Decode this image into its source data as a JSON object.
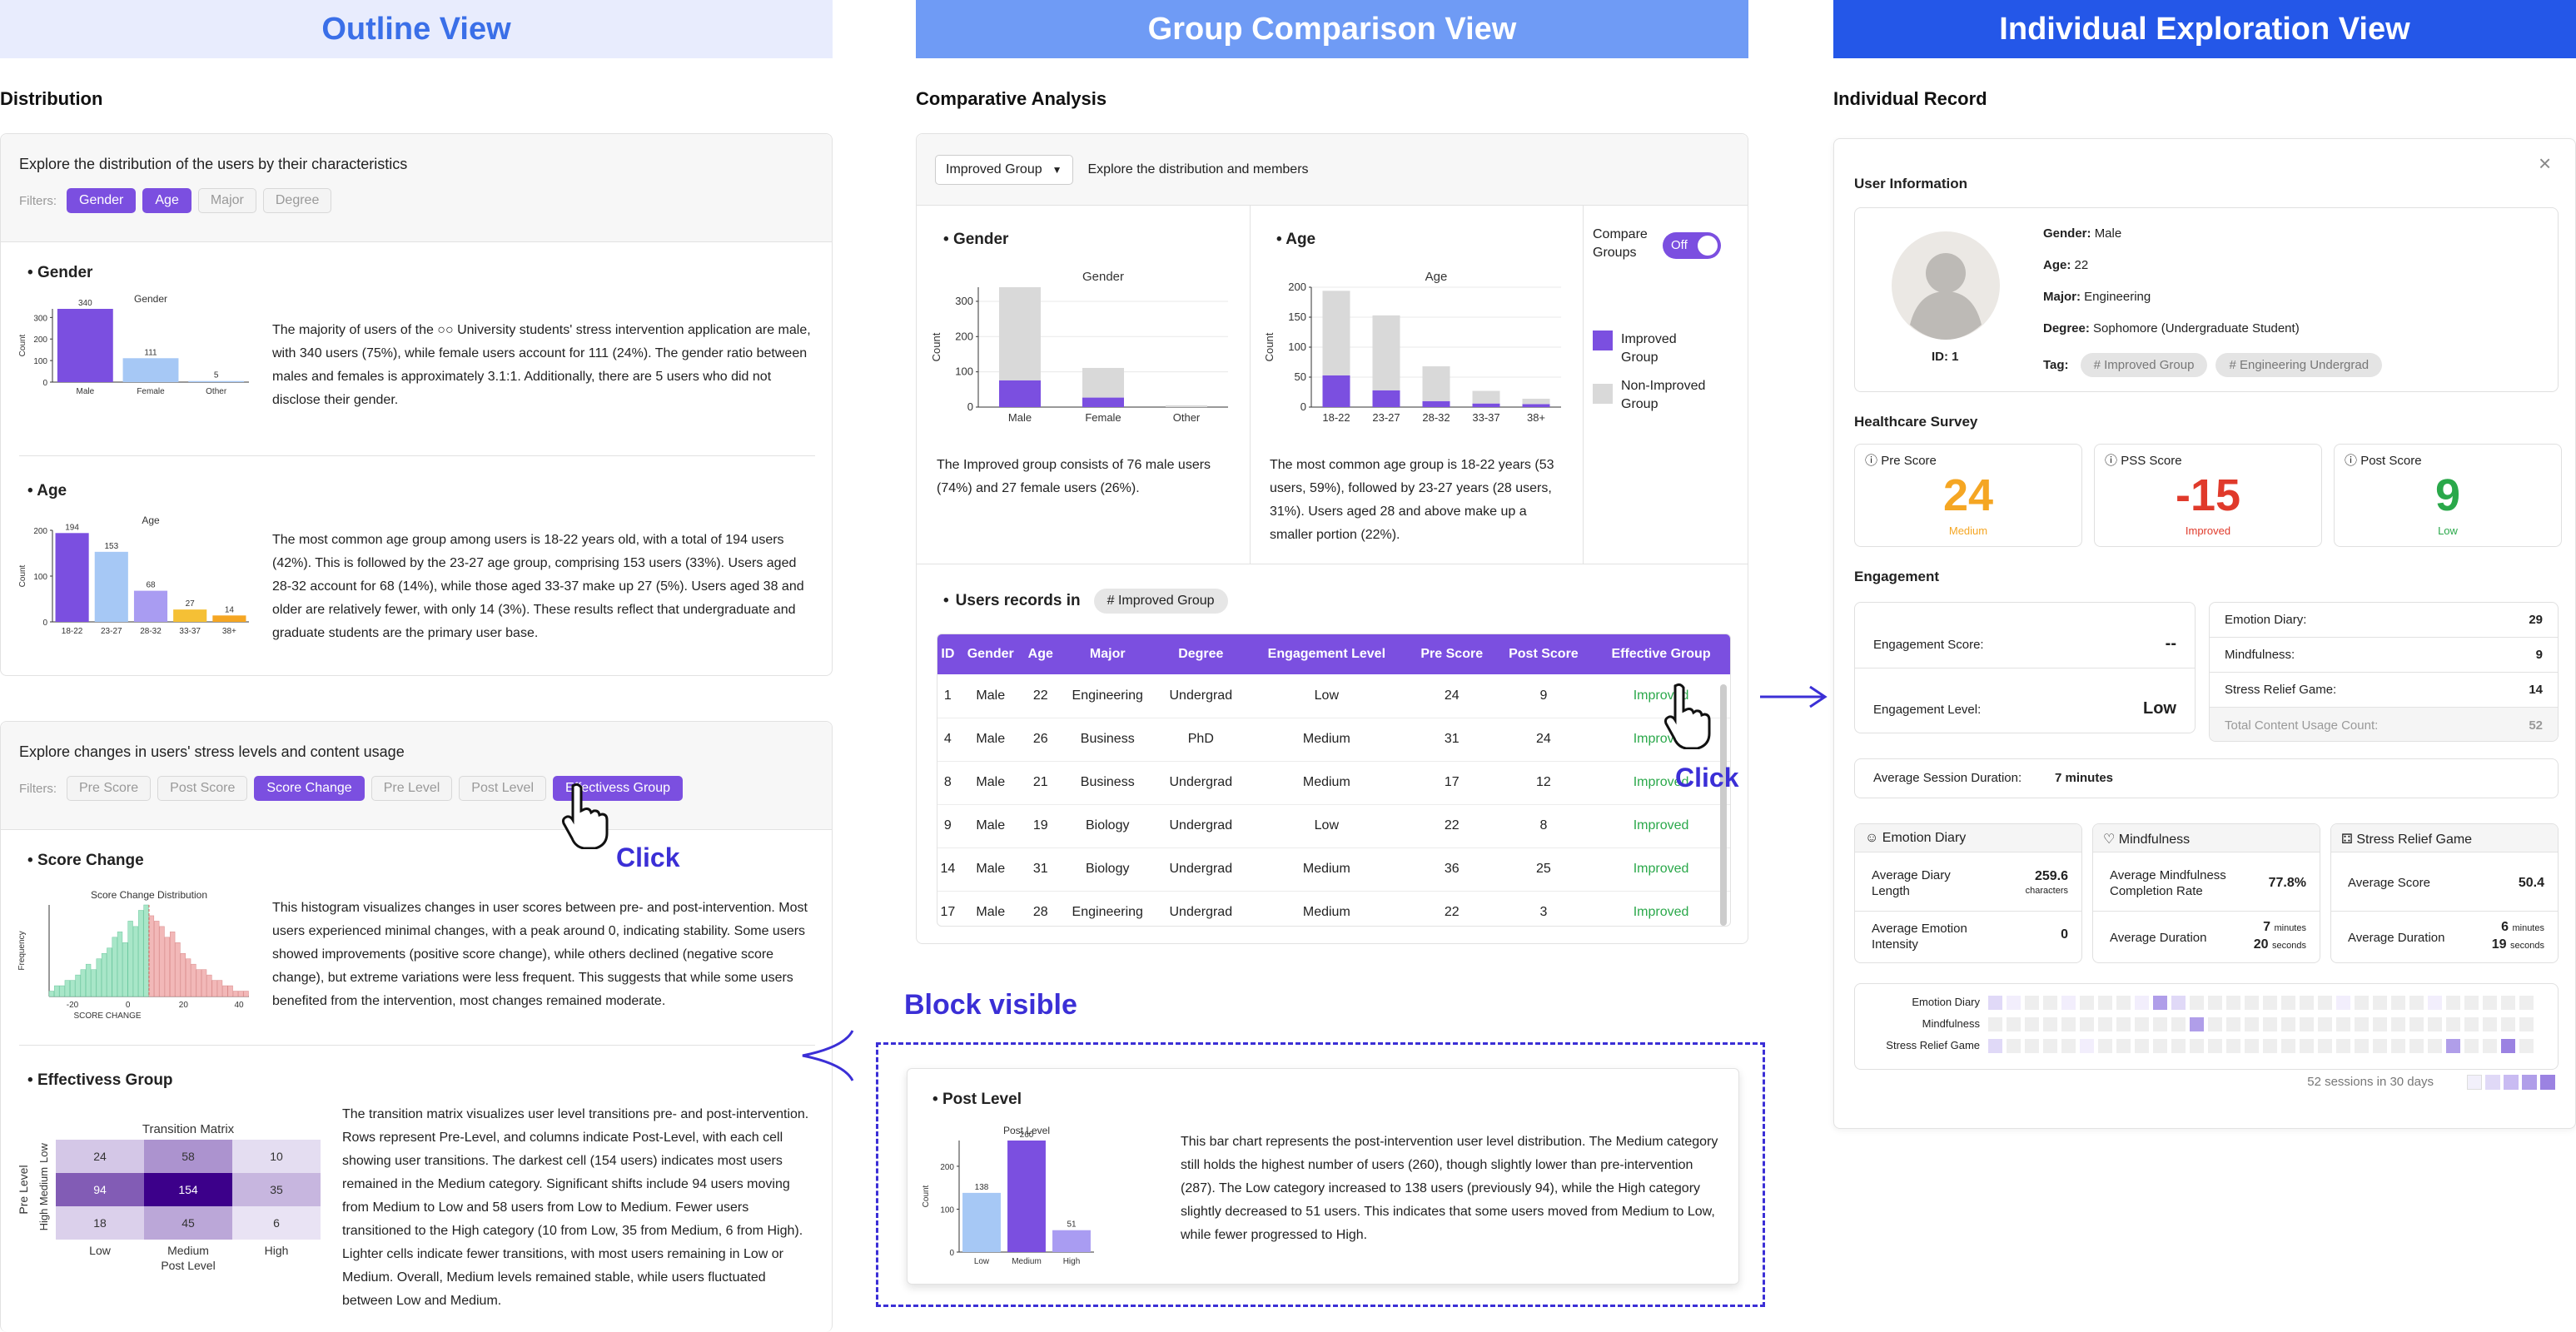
{
  "colors": {
    "purple": "#7b4fe0",
    "light_purple": "#a99cf2",
    "light_blue": "#a6c8f5",
    "yellow": "#f5c035",
    "orange": "#f5a623",
    "gray_bar": "#d9d9d9",
    "red": "#e03a2b",
    "green": "#2aa84a",
    "banner1": "#e8ecfd",
    "banner2": "#6f9bf5",
    "banner3": "#2457e8",
    "dash": "#3b2fd6"
  },
  "banners": {
    "outline": "Outline View",
    "group": "Group Comparison View",
    "individual": "Individual Exploration View"
  },
  "outline": {
    "section_title": "Distribution",
    "card1": {
      "prompt": "Explore the distribution of the users by their characteristics",
      "filters_label": "Filters:",
      "filters": [
        {
          "label": "Gender",
          "active": true
        },
        {
          "label": "Age",
          "active": true
        },
        {
          "label": "Major",
          "active": false
        },
        {
          "label": "Degree",
          "active": false
        }
      ]
    },
    "gender": {
      "heading": "Gender",
      "text": "The majority of users of the ○○ University students' stress intervention application are male, with 340 users (75%), while female users account for 111 (24%). The gender ratio between males and females is approximately 3.1:1. Additionally, there are 5 users who did not disclose their gender."
    },
    "age": {
      "heading": "Age",
      "text": "The most common age group among users is 18-22 years old, with a total of 194 users (42%). This is followed by the 23-27 age group, comprising 153 users (33%). Users aged 28-32 account for 68 (14%), while those aged 33-37 make up 27 (5%). Users aged 38 and older are relatively fewer, with only 14 (3%). These results reflect that undergraduate and graduate students are the primary user base."
    },
    "card2": {
      "prompt": "Explore changes in users' stress levels and content usage",
      "filters_label": "Filters:",
      "filters": [
        {
          "label": "Pre Score",
          "active": false
        },
        {
          "label": "Post Score",
          "active": false
        },
        {
          "label": "Score Change",
          "active": true
        },
        {
          "label": "Pre Level",
          "active": false
        },
        {
          "label": "Post Level",
          "active": false
        },
        {
          "label": "Effectivess Group",
          "active": true
        }
      ],
      "click_label": "Click"
    },
    "score_change": {
      "heading": "Score Change",
      "text": "This histogram visualizes changes in user scores between pre- and post-intervention. Most users experienced minimal changes, with a peak around 0, indicating stability. Some users showed improvements (positive score change), while others declined (negative score change), but extreme variations were less frequent. This suggests that while some users benefited from the intervention, most changes remained moderate."
    },
    "effect_group": {
      "heading": "Effectivess Group",
      "text": "The transition matrix visualizes user level transitions pre- and post-intervention. Rows represent Pre-Level, and columns indicate Post-Level, with each cell showing user transitions. The darkest cell (154 users) indicates most users remained in the Medium category. Significant shifts include 94 users moving from Medium to Low and 58 users from Low to Medium. Fewer users transitioned to the High category (10 from Low, 35 from Medium, 6 from High). Lighter cells indicate fewer transitions, with most users remaining in Low or Medium. Overall, Medium levels remained stable, while users fluctuated between Low and Medium."
    }
  },
  "group": {
    "section_title": "Comparative Analysis",
    "dropdown": "Improved Group",
    "dropdown_hint": "Explore the distribution and members",
    "gender": {
      "heading": "Gender",
      "text": "The Improved group consists of 76 male users (74%) and 27 female users (26%)."
    },
    "age": {
      "heading": "Age",
      "text": "The most common age group is 18-22 years (53 users, 59%), followed by 23-27 years (28 users, 31%). Users aged 28 and above make up a smaller portion (22%)."
    },
    "compare": {
      "label": "Compare Groups",
      "toggle": "Off",
      "legend_improved": "Improved Group",
      "legend_non": "Non-Improved Group"
    },
    "records": {
      "heading": "Users records in",
      "tag": "# Improved Group",
      "columns": [
        "ID",
        "Gender",
        "Age",
        "Major",
        "Degree",
        "Engagement Level",
        "Pre Score",
        "Post Score",
        "Effective Group"
      ],
      "rows": [
        [
          "1",
          "Male",
          "22",
          "Engineering",
          "Undergrad",
          "Low",
          "24",
          "9",
          "Improved"
        ],
        [
          "4",
          "Male",
          "26",
          "Business",
          "PhD",
          "Medium",
          "31",
          "24",
          "Improved"
        ],
        [
          "8",
          "Male",
          "21",
          "Business",
          "Undergrad",
          "Medium",
          "17",
          "12",
          "Improved"
        ],
        [
          "9",
          "Male",
          "19",
          "Biology",
          "Undergrad",
          "Low",
          "22",
          "8",
          "Improved"
        ],
        [
          "14",
          "Male",
          "31",
          "Biology",
          "Undergrad",
          "Medium",
          "36",
          "25",
          "Improved"
        ],
        [
          "17",
          "Male",
          "28",
          "Engineering",
          "Undergrad",
          "Medium",
          "22",
          "3",
          "Improved"
        ]
      ]
    },
    "click_label": "Click",
    "block_visible": "Block visible",
    "post_level": {
      "heading": "Post Level",
      "text": "This bar chart represents the post-intervention user level distribution. The Medium category still holds the highest number of users (260), though slightly lower than pre-intervention (287). The Low category increased to 138 users (previously 94), while the High category slightly decreased to 51 users. This indicates that some users moved from Medium to Low, while fewer progressed to High."
    }
  },
  "individual": {
    "section_title": "Individual Record",
    "user_info_title": "User Information",
    "id_label": "ID: 1",
    "fields": [
      {
        "k": "Gender:",
        "v": "Male"
      },
      {
        "k": "Age:",
        "v": "22"
      },
      {
        "k": "Major:",
        "v": "Engineering"
      },
      {
        "k": "Degree:",
        "v": "Sophomore (Undergraduate Student)"
      }
    ],
    "tag_label": "Tag:",
    "tags": [
      "# Improved Group",
      "# Engineering Undergrad"
    ],
    "survey_title": "Healthcare Survey",
    "scores": [
      {
        "label": "Pre Score",
        "value": "24",
        "sub": "Medium",
        "color": "#f5a623"
      },
      {
        "label": "PSS Score",
        "value": "-15",
        "sub": "Improved",
        "color": "#e03a2b"
      },
      {
        "label": "Post Score",
        "value": "9",
        "sub": "Low",
        "color": "#2aa84a"
      }
    ],
    "engagement_title": "Engagement",
    "eng_score_label": "Engagement Score:",
    "eng_score": "--",
    "eng_level_label": "Engagement Level:",
    "eng_level": "Low",
    "usage": [
      {
        "k": "Emotion Diary:",
        "v": "29"
      },
      {
        "k": "Mindfulness:",
        "v": "9"
      },
      {
        "k": "Stress Relief Game:",
        "v": "14"
      },
      {
        "k": "Total Content Usage Count:",
        "v": "52"
      }
    ],
    "session_label": "Average Session Duration:",
    "session_value": "7 minutes",
    "diary": {
      "title": "Emotion Diary",
      "r1k": "Average Diary Length",
      "r1v": "259.6",
      "r1u": "characters",
      "r2k": "Average Emotion Intensity",
      "r2v": "0"
    },
    "mind": {
      "title": "Mindfulness",
      "r1k": "Average Mindfulness Completion Rate",
      "r1v": "77.8%",
      "r2k": "Average Duration",
      "r2a": "7",
      "r2au": "minutes",
      "r2b": "20",
      "r2bu": "seconds"
    },
    "game": {
      "title": "Stress Relief Game",
      "r1k": "Average Score",
      "r1v": "50.4",
      "r2k": "Average Duration",
      "r2a": "6",
      "r2au": "minutes",
      "r2b": "19",
      "r2bu": "seconds"
    },
    "heat_rows": [
      "Emotion Diary",
      "Mindfulness",
      "Stress Relief Game"
    ],
    "sessions_text": "52 sessions in 30 days"
  },
  "charts": {
    "gender": {
      "type": "bar",
      "title": "Gender",
      "ylabel": "Count",
      "categories": [
        "Male",
        "Female",
        "Other"
      ],
      "values": [
        340,
        111,
        5
      ],
      "ylim": [
        0,
        340
      ],
      "yticks": [
        0,
        100,
        200,
        300
      ]
    },
    "age": {
      "type": "bar",
      "title": "Age",
      "ylabel": "Count",
      "categories": [
        "18-22",
        "23-27",
        "28-32",
        "33-37",
        "38+"
      ],
      "values": [
        194,
        153,
        68,
        27,
        14
      ],
      "ylim": [
        0,
        200
      ],
      "yticks": [
        0,
        100,
        200
      ]
    },
    "score_change": {
      "type": "histogram",
      "title": "Score Change Distribution",
      "xlabel": "SCORE CHANGE",
      "ylabel": "Frequency",
      "xticks": [
        "-20",
        "0",
        "20",
        "40"
      ],
      "values": [
        1,
        2,
        2,
        3,
        3,
        4,
        5,
        6,
        5,
        7,
        8,
        9,
        11,
        12,
        10,
        14,
        13,
        16,
        17,
        15,
        14,
        13,
        11,
        12,
        10,
        8,
        7,
        6,
        5,
        5,
        4,
        3,
        3,
        2,
        2,
        1,
        1,
        1
      ]
    },
    "matrix": {
      "type": "heatmap",
      "title": "Transition Matrix",
      "ylabel": "Pre Level",
      "xlabel": "Post Level",
      "rows": [
        "Low",
        "Medium",
        "High"
      ],
      "cols": [
        "Low",
        "Medium",
        "High"
      ],
      "values": [
        [
          24,
          58,
          10
        ],
        [
          94,
          154,
          35
        ],
        [
          18,
          45,
          6
        ]
      ]
    },
    "g_gender": {
      "type": "bar",
      "title": "Gender",
      "ylabel": "Count",
      "categories": [
        "Male",
        "Female",
        "Other"
      ],
      "series": [
        {
          "name": "Improved Group",
          "values": [
            76,
            27,
            0
          ]
        },
        {
          "name": "Non-Improved Group",
          "values": [
            264,
            84,
            5
          ]
        }
      ],
      "ylim": [
        0,
        340
      ],
      "yticks": [
        0,
        100,
        200,
        300
      ]
    },
    "g_age": {
      "type": "bar",
      "title": "Age",
      "ylabel": "Count",
      "categories": [
        "18-22",
        "23-27",
        "28-32",
        "33-37",
        "38+"
      ],
      "series": [
        {
          "name": "Improved Group",
          "values": [
            53,
            28,
            10,
            6,
            5
          ]
        },
        {
          "name": "Non-Improved Group",
          "values": [
            141,
            125,
            58,
            21,
            9
          ]
        }
      ],
      "ylim": [
        0,
        200
      ],
      "yticks": [
        0,
        50,
        100,
        150,
        200
      ]
    },
    "post_level": {
      "type": "bar",
      "title": "Post Level",
      "ylabel": "Count",
      "categories": [
        "Low",
        "Medium",
        "High"
      ],
      "values": [
        138,
        260,
        51
      ],
      "ylim": [
        0,
        260
      ],
      "yticks": [
        0,
        100,
        200
      ]
    }
  }
}
